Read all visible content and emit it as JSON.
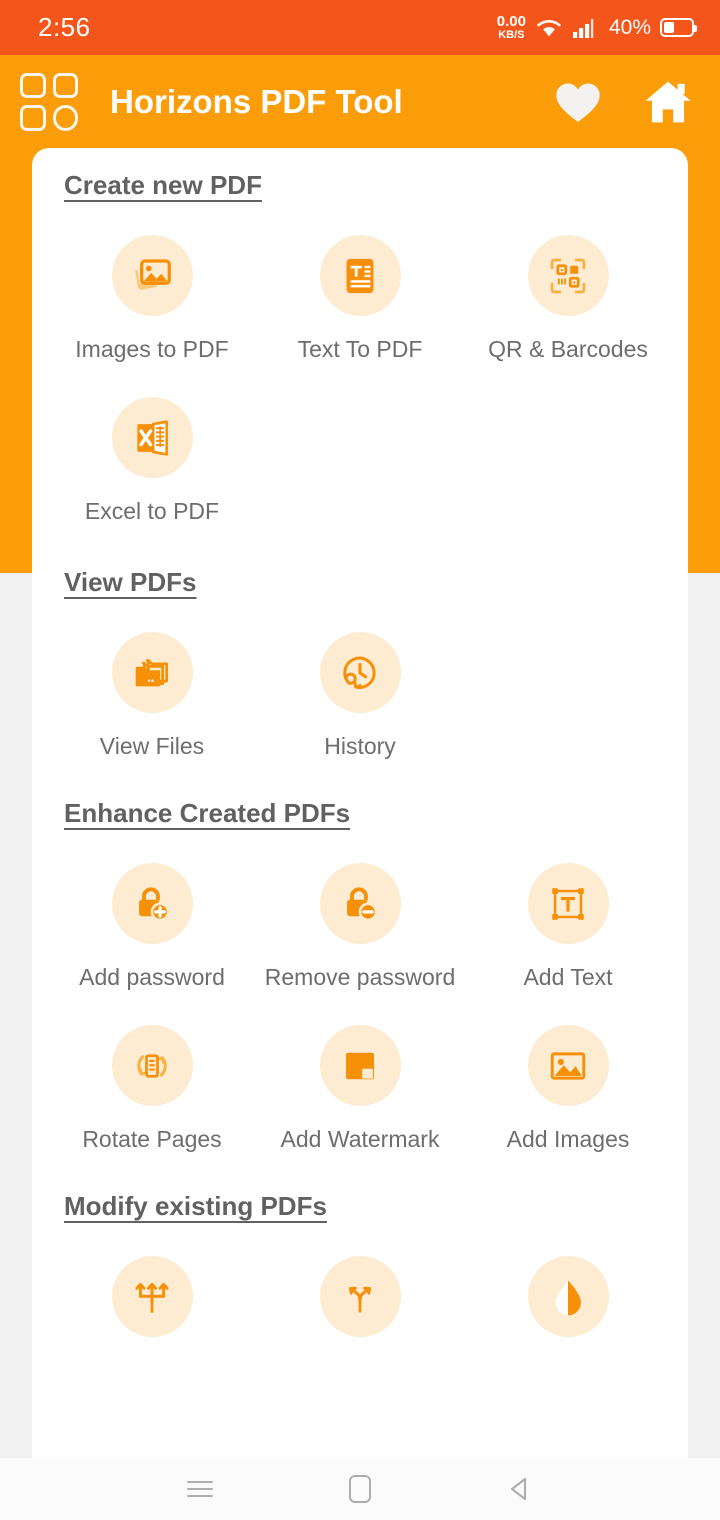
{
  "status_bar": {
    "time": "2:56",
    "net_speed_value": "0.00",
    "net_speed_unit": "KB/S",
    "wifi_icon": "wifi-icon",
    "signal_icon": "signal-bars-icon",
    "battery_percent": "40%",
    "battery_icon": "battery-icon",
    "background_color": "#F4551B"
  },
  "app_bar": {
    "menu_icon": "grid-menu-icon",
    "title": "Horizons PDF Tool",
    "favorite_icon": "heart-icon",
    "home_icon": "home-icon",
    "background_color": "#FB9D09"
  },
  "sections": [
    {
      "title": "Create new PDF",
      "tools": [
        {
          "label": "Images to PDF",
          "icon": "image-stack-icon"
        },
        {
          "label": "Text To PDF",
          "icon": "text-document-icon"
        },
        {
          "label": "QR & Barcodes",
          "icon": "qr-code-icon"
        },
        {
          "label": "Excel to PDF",
          "icon": "excel-sheet-icon"
        }
      ]
    },
    {
      "title": "View PDFs",
      "tools": [
        {
          "label": "View Files",
          "icon": "folder-files-icon"
        },
        {
          "label": "History",
          "icon": "clock-history-icon"
        }
      ]
    },
    {
      "title": "Enhance Created PDFs",
      "tools": [
        {
          "label": "Add password",
          "icon": "lock-plus-icon"
        },
        {
          "label": "Remove password",
          "icon": "lock-minus-icon"
        },
        {
          "label": "Add Text",
          "icon": "text-frame-icon"
        },
        {
          "label": "Rotate Pages",
          "icon": "rotate-page-icon"
        },
        {
          "label": "Add Watermark",
          "icon": "watermark-square-icon"
        },
        {
          "label": "Add Images",
          "icon": "picture-icon"
        }
      ]
    },
    {
      "title": "Modify existing PDFs",
      "tools": [
        {
          "label": "",
          "icon": "merge-arrows-icon"
        },
        {
          "label": "",
          "icon": "split-arrows-icon"
        },
        {
          "label": "",
          "icon": "compress-drop-icon"
        }
      ]
    }
  ],
  "nav_bar": {
    "recents_icon": "recents-menu-icon",
    "home_icon": "home-square-icon",
    "back_icon": "back-triangle-icon"
  },
  "colors": {
    "accent_orange": "#F79009",
    "icon_circle": "#FDEBD2",
    "status_orange": "#F4551B",
    "header_orange": "#FB9D09",
    "label_gray": "#6d6d6d",
    "page_background": "#f1f1f1"
  }
}
